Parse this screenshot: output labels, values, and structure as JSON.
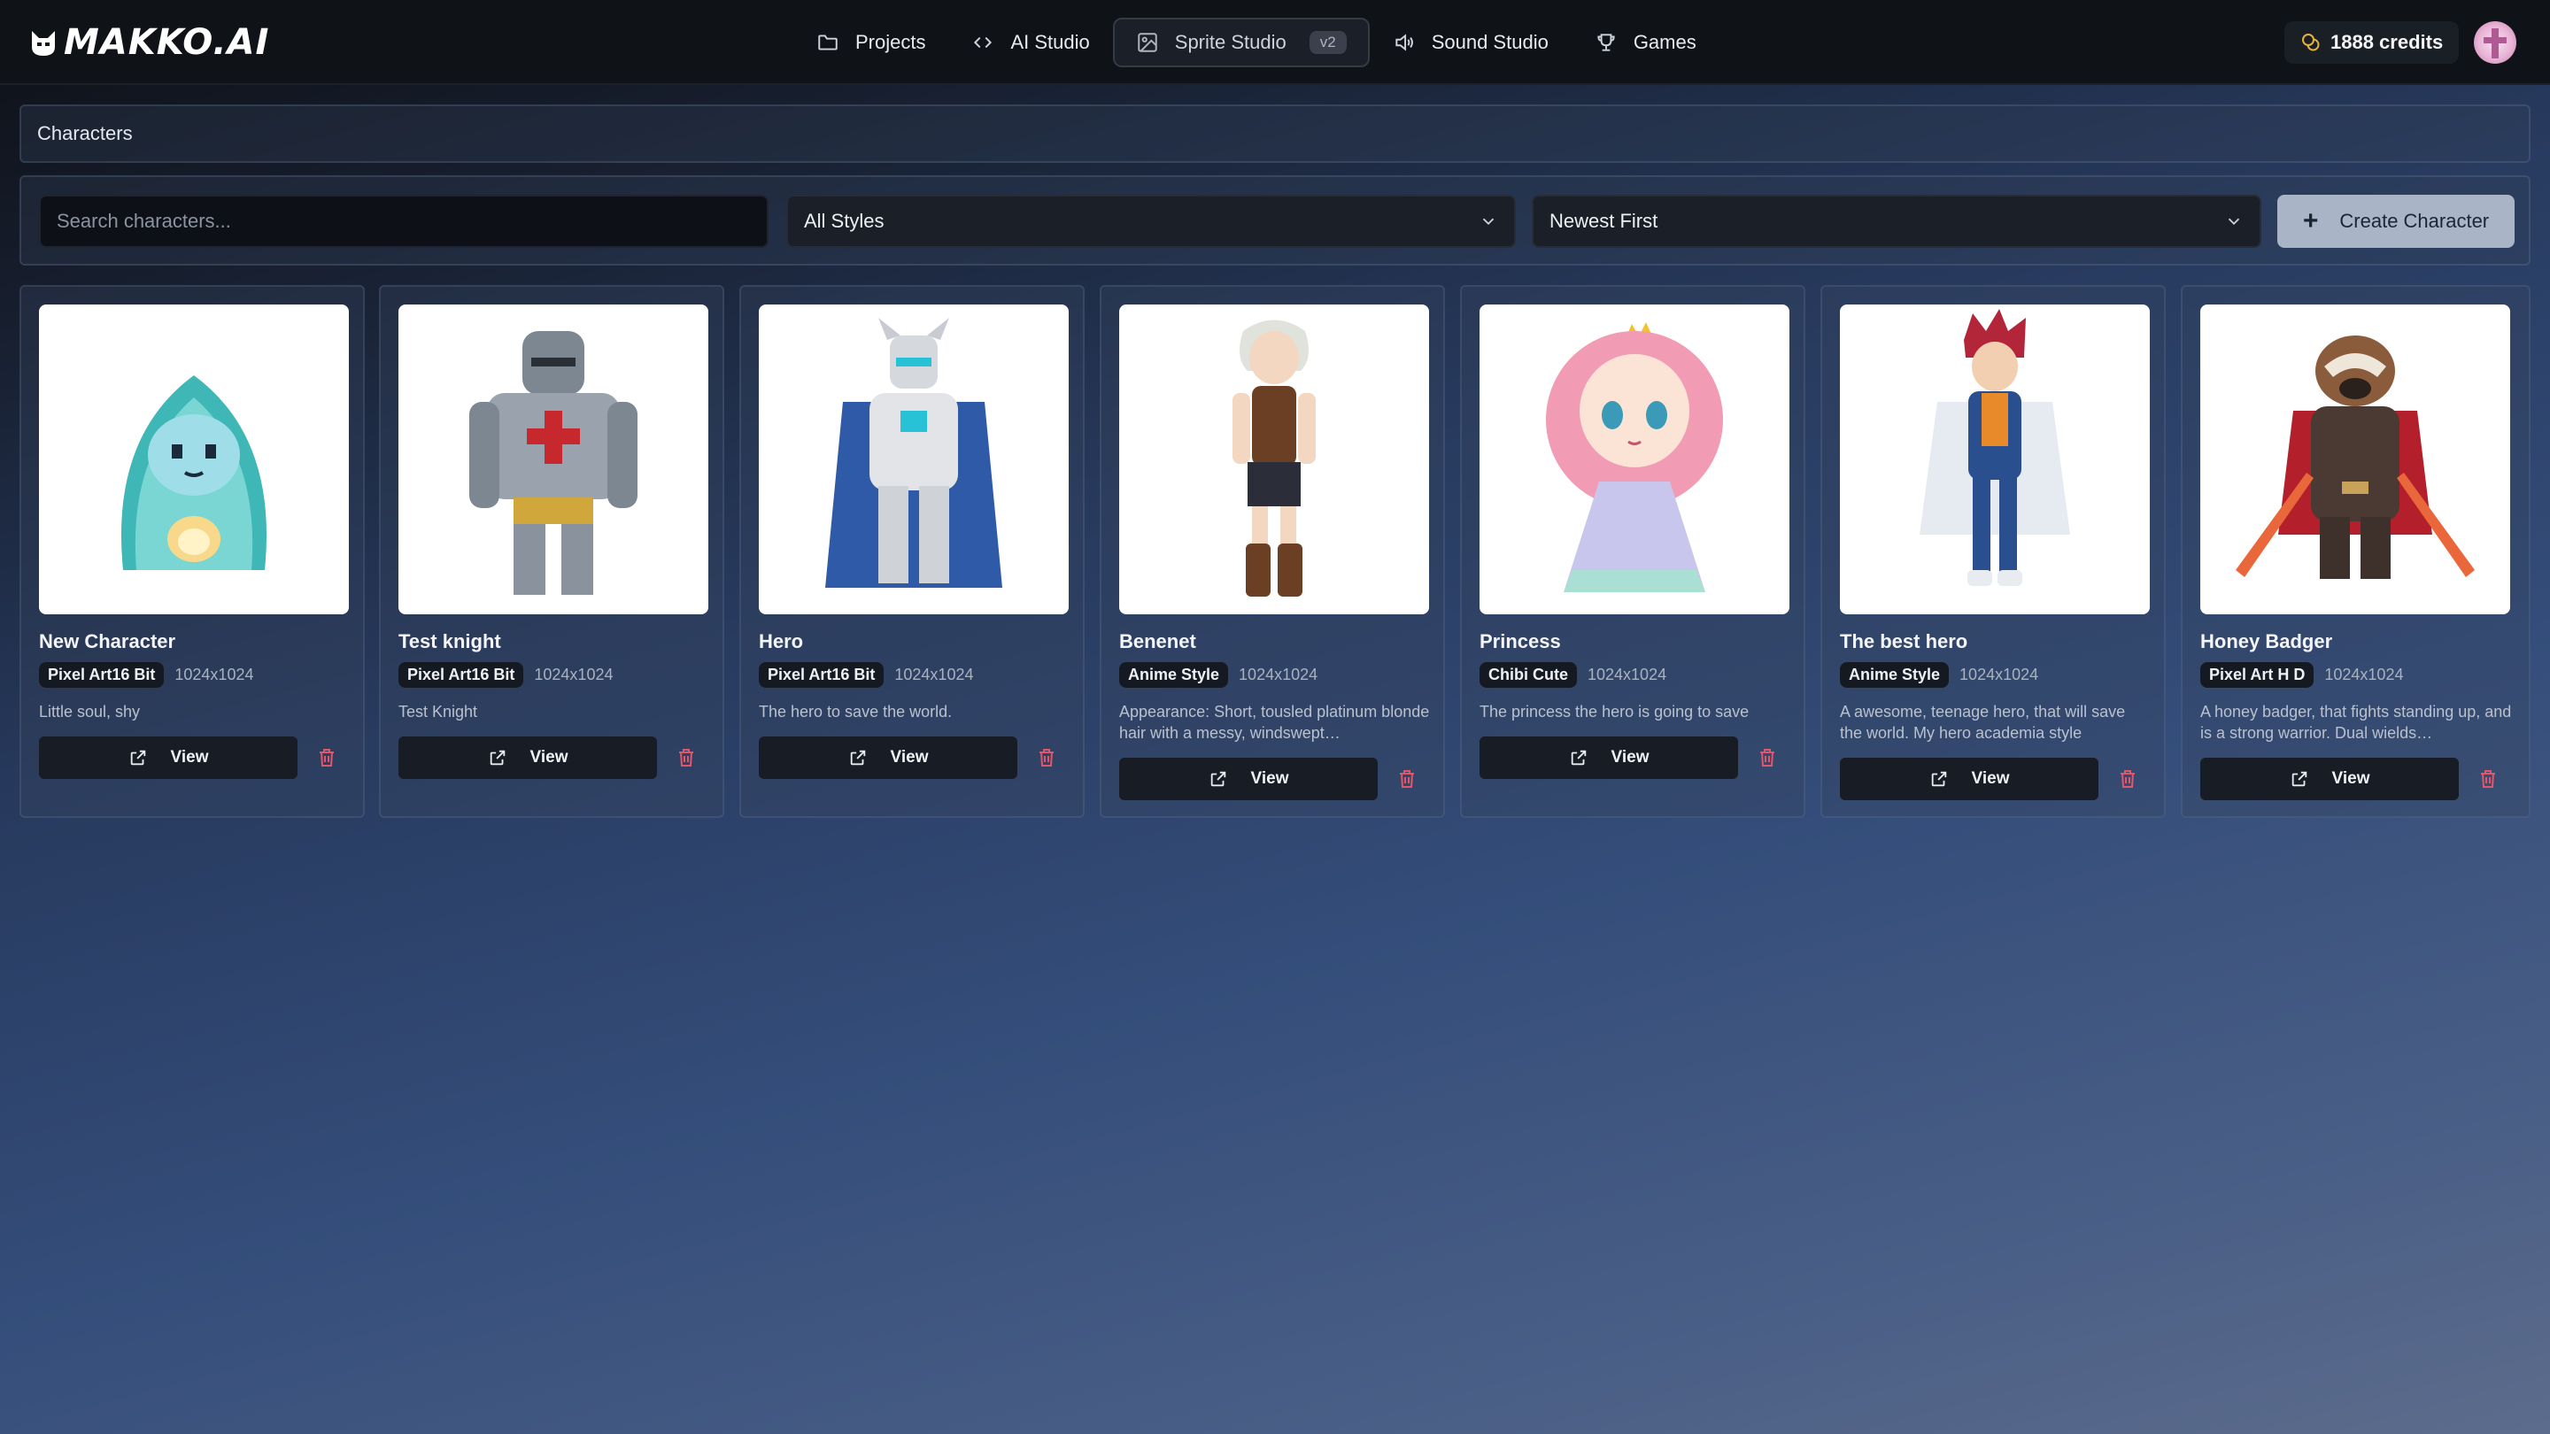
{
  "brand": {
    "name": "MAKKO.AI",
    "logo_icon": "cat-mask-icon"
  },
  "nav": [
    {
      "label": "Projects",
      "icon": "folder-icon"
    },
    {
      "label": "AI Studio",
      "icon": "code-icon"
    },
    {
      "label": "Sprite Studio",
      "icon": "image-icon",
      "badge": "v2",
      "active": true
    },
    {
      "label": "Sound Studio",
      "icon": "speaker-icon"
    },
    {
      "label": "Games",
      "icon": "trophy-icon"
    }
  ],
  "credits": {
    "label": "1888 credits",
    "icon": "coins-icon"
  },
  "section": {
    "title": "Characters"
  },
  "filters": {
    "search_placeholder": "Search characters...",
    "style_select": "All Styles",
    "sort_select": "Newest First",
    "create_label": "Create Character"
  },
  "card_actions": {
    "view_label": "View"
  },
  "characters": [
    {
      "name": "New Character",
      "style": "Pixel Art16 Bit",
      "dims": "1024x1024",
      "description": "Little soul, shy"
    },
    {
      "name": "Test knight",
      "style": "Pixel Art16 Bit",
      "dims": "1024x1024",
      "description": "Test Knight"
    },
    {
      "name": "Hero",
      "style": "Pixel Art16 Bit",
      "dims": "1024x1024",
      "description": "The hero to save the world."
    },
    {
      "name": "Benenet",
      "style": "Anime Style",
      "dims": "1024x1024",
      "description": "Appearance: Short, tousled platinum blonde hair with a messy, windswept…"
    },
    {
      "name": "Princess",
      "style": "Chibi Cute",
      "dims": "1024x1024",
      "description": "The princess the hero is going to save"
    },
    {
      "name": "The best hero",
      "style": "Anime Style",
      "dims": "1024x1024",
      "description": "A awesome, teenage hero, that will save the world. My hero academia style"
    },
    {
      "name": "Honey Badger",
      "style": "Pixel Art H D",
      "dims": "1024x1024",
      "description": "A honey badger, that fights standing up, and is a strong warrior. Dual wields…"
    }
  ],
  "colors": {
    "accent_button": "#a9b5c6",
    "delete_red": "#e0566b",
    "credits_gold": "#e8b23a"
  }
}
